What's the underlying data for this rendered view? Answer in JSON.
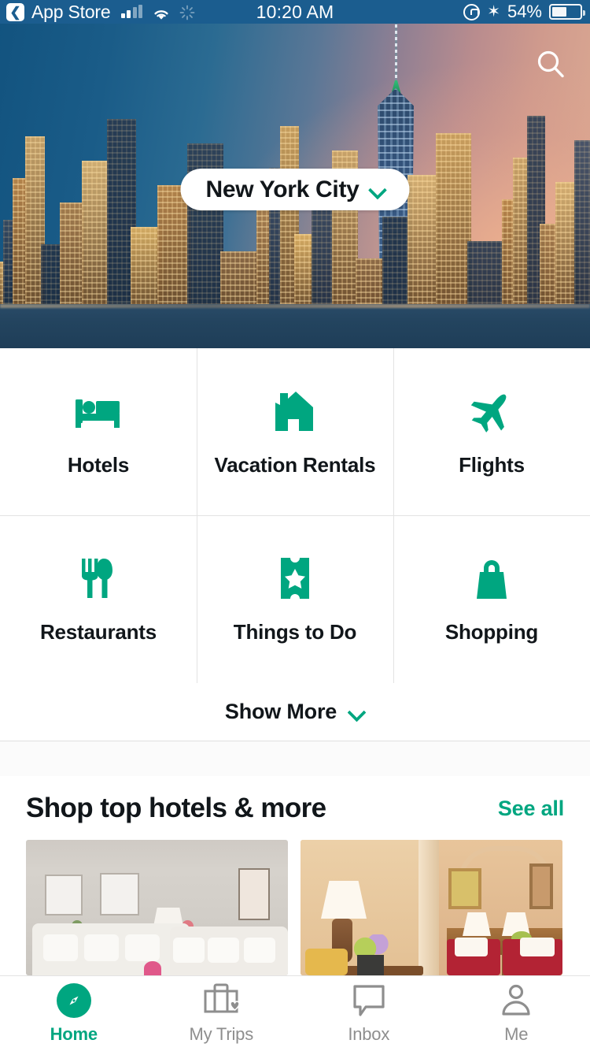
{
  "status_bar": {
    "back_label": "App Store",
    "back_icon": "chevron-left-icon",
    "signal_icon": "cellular-signal-icon",
    "wifi_icon": "wifi-icon",
    "spinner_icon": "activity-spinner-icon",
    "time": "10:20 AM",
    "rotation_lock_icon": "rotation-lock-icon",
    "bluetooth_icon": "bluetooth-icon",
    "battery_percent": "54%",
    "battery_icon": "battery-icon"
  },
  "hero": {
    "image_alt": "New York City skyline at dusk",
    "search_icon": "search-icon",
    "location": {
      "name": "New York City",
      "chevron_icon": "chevron-down-icon"
    }
  },
  "categories": {
    "tiles": [
      {
        "label": "Hotels",
        "icon": "bed-icon"
      },
      {
        "label": "Vacation Rentals",
        "icon": "house-icon"
      },
      {
        "label": "Flights",
        "icon": "airplane-icon"
      },
      {
        "label": "Restaurants",
        "icon": "fork-knife-icon"
      },
      {
        "label": "Things to Do",
        "icon": "ticket-star-icon"
      },
      {
        "label": "Shopping",
        "icon": "shopping-bag-icon"
      }
    ],
    "show_more": {
      "label": "Show More",
      "chevron_icon": "chevron-down-icon"
    }
  },
  "shop_section": {
    "title": "Shop top hotels & more",
    "see_all_label": "See all",
    "cards": [
      {
        "image_alt": "Bright hotel suite living room with white sofas and framed art"
      },
      {
        "image_alt": "Warm hotel bedroom with lamps, red bedding and flowers"
      }
    ]
  },
  "tabbar": {
    "tabs": [
      {
        "label": "Home",
        "icon": "compass-icon",
        "active": true
      },
      {
        "label": "My Trips",
        "icon": "suitcase-heart-icon",
        "active": false
      },
      {
        "label": "Inbox",
        "icon": "speech-bubble-icon",
        "active": false
      },
      {
        "label": "Me",
        "icon": "person-icon",
        "active": false
      }
    ]
  },
  "colors": {
    "brand_green": "#00a680",
    "status_bar_blue": "#1b5d8f",
    "text_dark": "#11161a",
    "muted_grey": "#8e8e8e"
  }
}
